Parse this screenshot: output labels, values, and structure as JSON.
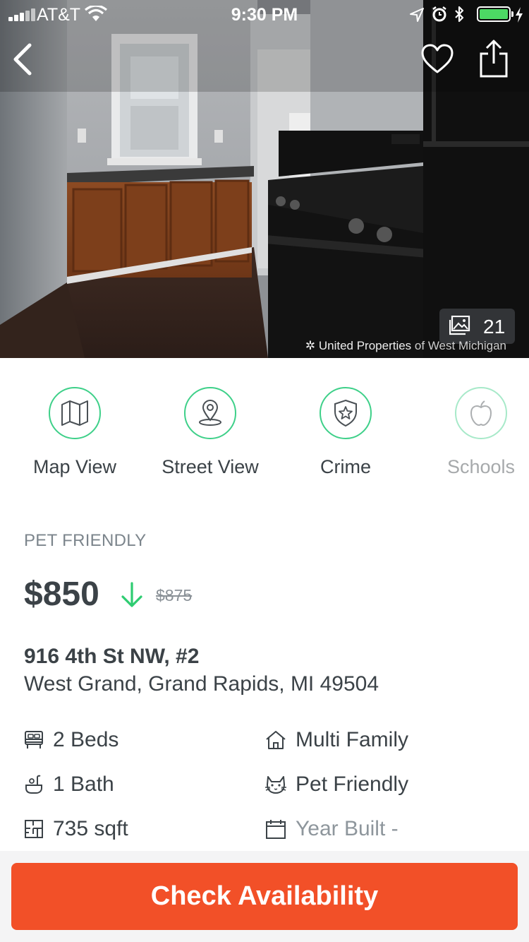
{
  "status_bar": {
    "carrier": "AT&T",
    "time": "9:30 PM",
    "battery_color": "#4cd964"
  },
  "hero": {
    "photo_count": "21",
    "watermark_brand": "United Properties",
    "watermark_suffix": "of West Michigan",
    "icons": {
      "back": "chevron-left-icon",
      "favorite": "heart-icon",
      "share": "share-icon",
      "photos": "photo-gallery-icon"
    }
  },
  "actions": [
    {
      "label": "Map View",
      "icon": "map-icon"
    },
    {
      "label": "Street View",
      "icon": "location-pin-icon"
    },
    {
      "label": "Crime",
      "icon": "shield-star-icon"
    },
    {
      "label": "Schools",
      "icon": "apple-icon"
    }
  ],
  "listing": {
    "tag": "PET FRIENDLY",
    "price": "$850",
    "old_price": "$875",
    "address_line1": "916 4th St NW, #2",
    "address_line2": "West Grand, Grand Rapids, MI 49504",
    "features": [
      {
        "label": "2 Beds",
        "icon": "bed-icon"
      },
      {
        "label": "Multi Family",
        "icon": "house-icon"
      },
      {
        "label": "1 Bath",
        "icon": "bath-icon"
      },
      {
        "label": "Pet Friendly",
        "icon": "cat-icon"
      },
      {
        "label": "735 sqft",
        "icon": "floorplan-icon"
      },
      {
        "label": "Year Built -",
        "icon": "calendar-icon"
      }
    ]
  },
  "cta": {
    "label": "Check Availability",
    "color": "#f25028"
  },
  "accent_color": "#3ed089"
}
